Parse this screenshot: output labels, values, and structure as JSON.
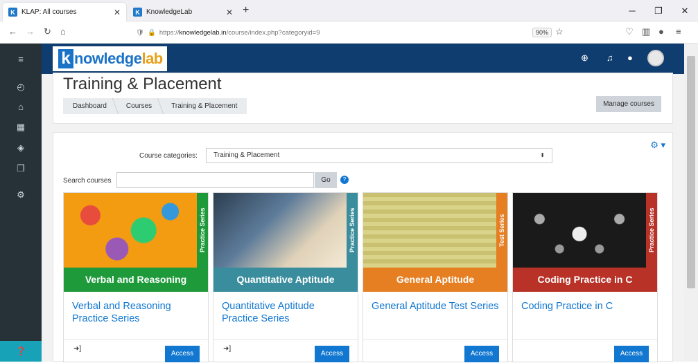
{
  "browser": {
    "tabs": [
      {
        "title": "KLAP: All courses",
        "active": true
      },
      {
        "title": "KnowledgeLab",
        "active": false
      }
    ],
    "url_prefix": "https://",
    "url_domain": "knowledgelab.in",
    "url_path": "/course/index.php?categoryid=9",
    "zoom": "90%"
  },
  "header": {
    "logo_k": "k",
    "logo_text": "nowledge",
    "logo_text_accent": "lab"
  },
  "page": {
    "title": "Training & Placement",
    "breadcrumb": [
      "Dashboard",
      "Courses",
      "Training & Placement"
    ],
    "manage_label": "Manage courses",
    "category_label": "Course categories:",
    "category_value": "Training & Placement",
    "search_label": "Search courses",
    "go_label": "Go"
  },
  "courses": [
    {
      "banner_side": "Practice Series",
      "banner_title": "Verbal and Reasoning",
      "name": "Verbal and Reasoning Practice Series",
      "access_label": "Access",
      "color": "#1e9a3a",
      "img": "#f39c12"
    },
    {
      "banner_side": "Practice Series",
      "banner_title": "Quantitative Aptitude",
      "name": "Quantitative Aptitude Practice Series",
      "access_label": "Access",
      "color": "#3a8d9c",
      "img": "#3d5a78"
    },
    {
      "banner_side": "Test Series",
      "banner_title": "General Aptitude",
      "name": "General Aptitude Test Series",
      "access_label": "Access",
      "color": "#e67e22",
      "img": "#c8c070"
    },
    {
      "banner_side": "Practice Series",
      "banner_title": "Coding Practice in C",
      "name": "Coding Practice in C",
      "access_label": "Access",
      "color": "#b83227",
      "img": "#222"
    }
  ]
}
